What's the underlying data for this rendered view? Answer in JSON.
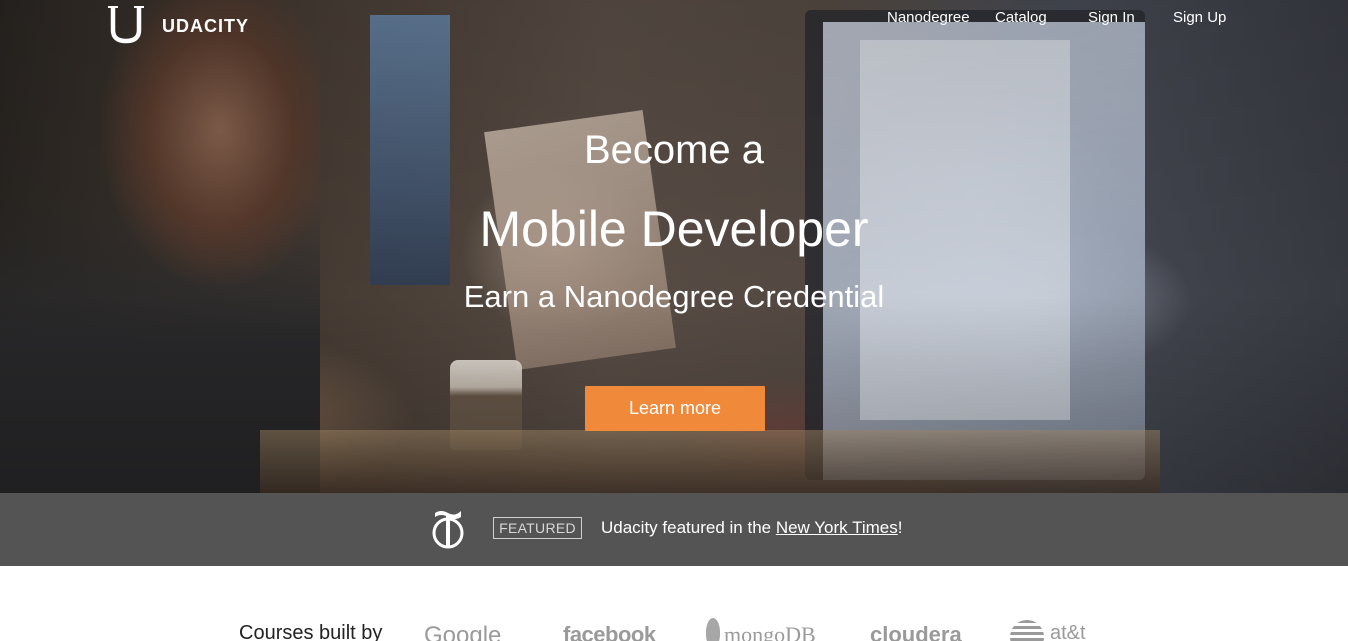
{
  "brand": {
    "name": "UDACITY",
    "logo_icon": "udacity-u-logo"
  },
  "nav": {
    "items": [
      {
        "label": "Nanodegree"
      },
      {
        "label": "Catalog"
      },
      {
        "label": "Sign In"
      },
      {
        "label": "Sign Up"
      }
    ]
  },
  "hero": {
    "line1": "Become a",
    "line2": "Mobile Developer",
    "line3": "Earn a Nanodegree Credential",
    "cta_label": "Learn more",
    "cta_color": "#f0893a"
  },
  "featured": {
    "icon": "nyt-t-logo",
    "badge": "FEATURED",
    "text_before": "Udacity featured in the ",
    "link_text": "New York Times",
    "text_after": "!",
    "bar_color": "#545454"
  },
  "partners": {
    "label": "Courses built by",
    "logos": [
      "Google",
      "facebook",
      "mongoDB",
      "cloudera",
      "at&t"
    ]
  }
}
